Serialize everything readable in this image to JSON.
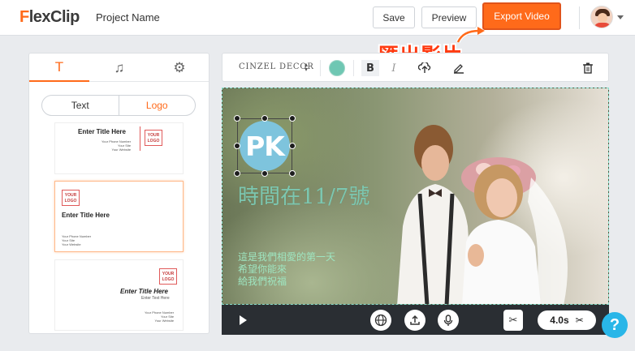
{
  "header": {
    "logo_prefix": "F",
    "logo_rest": "lexClip",
    "project_name": "Project Name",
    "save_label": "Save",
    "preview_label": "Preview",
    "export_label": "Export Video"
  },
  "annotation": {
    "text": "匯出影片",
    "color": "#ff3a10"
  },
  "left_panel": {
    "tabs": [
      {
        "icon": "text-icon",
        "glyph": "T",
        "active": true
      },
      {
        "icon": "music-icon",
        "glyph": "♫",
        "active": false
      },
      {
        "icon": "gear-icon",
        "glyph": "⚙",
        "active": false
      }
    ],
    "segments": {
      "text_label": "Text",
      "logo_label": "Logo",
      "selected": "Logo"
    },
    "cards": [
      {
        "logo": "YOUR LOGO",
        "title": "Enter Title Here",
        "lines": [
          "Your Phone Number",
          "Your Site",
          "Your Website"
        ]
      },
      {
        "logo": "YOUR LOGO",
        "title": "Enter Title Here",
        "lines": [
          "Your Phone Number",
          "Your Site",
          "Your Website"
        ]
      },
      {
        "logo": "YOUR LOGO",
        "title": "Enter Title Here",
        "subtitle": "Enter Text Here",
        "lines": [
          "Your Phone Number",
          "Your Site",
          "Your Website"
        ]
      }
    ]
  },
  "toolbar": {
    "font_name": "CINZEL DECOR",
    "color": "#6fc7b3",
    "bold_label": "B",
    "italic_label": "I"
  },
  "canvas": {
    "logo_text": "PK",
    "main_text": "時間在11/7號",
    "sub_lines": [
      "這是我們相愛的第一天",
      "希望你能來",
      "給我們祝福"
    ],
    "text_color": "#7cc7b0"
  },
  "player": {
    "duration": "4.0s"
  },
  "help_label": "?",
  "colors": {
    "accent": "#ff6a1a",
    "help": "#29b6e8"
  }
}
